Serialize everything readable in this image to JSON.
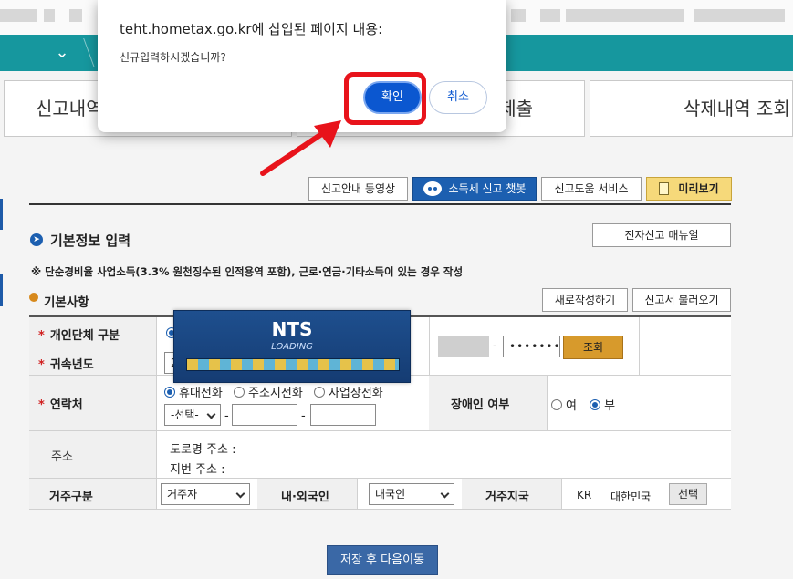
{
  "dialog": {
    "title": "teht.hometax.go.kr에 삽입된 페이지 내용:",
    "message": "신규입력하시겠습니까?",
    "ok_label": "확인",
    "cancel_label": "취소"
  },
  "tabs": [
    "신고내역",
    "제출",
    "삭제내역 조회"
  ],
  "toolbar": {
    "guide_video": "신고안내 동영상",
    "chatbot": "소득세 신고 챗봇",
    "help_service": "신고도움 서비스",
    "preview": "미리보기"
  },
  "section": {
    "title": "기본정보 입력",
    "manual_button": "전자신고 매뉴얼",
    "note": "※ 단순경비율 사업소득(3.3% 원천징수된 인적용역 포함), 근로·연금·기타소득이 있는 경우 작성"
  },
  "subsection": {
    "title": "기본사항",
    "new_button": "새로작성하기",
    "load_button": "신고서 불러오기"
  },
  "form": {
    "required_mark": "*",
    "type_label": "개인단체 구분",
    "year_label": "귀속년도",
    "year_value": "2",
    "id_separator": "-",
    "id_masked": "•••••••",
    "lookup_button": "조회",
    "contact_label": "연락처",
    "phone_options": [
      "휴대전화",
      "주소지전화",
      "사업장전화"
    ],
    "phone_select": "-선택-",
    "phone_dash": "-",
    "disability_label": "장애인 여부",
    "disability_yes": "여",
    "disability_no": "부",
    "address_label": "주소",
    "road_address": "도로명 주소 :",
    "lot_address": "지번 주소 :",
    "residence_label": "거주구분",
    "residence_value": "거주자",
    "nationality_label": "내·외국인",
    "nationality_value": "내국인",
    "country_label": "거주지국",
    "country_code": "KR",
    "country_name": "대한민국",
    "select_button": "선택"
  },
  "loading": {
    "title": "NTS",
    "subtitle": "LOADING"
  },
  "save_button": "저장 후 다음이동",
  "colors": {
    "nav_teal": "#16979e",
    "primary_blue": "#0b57d0",
    "highlight_red": "#e8131b",
    "gold": "#d79a2c"
  }
}
